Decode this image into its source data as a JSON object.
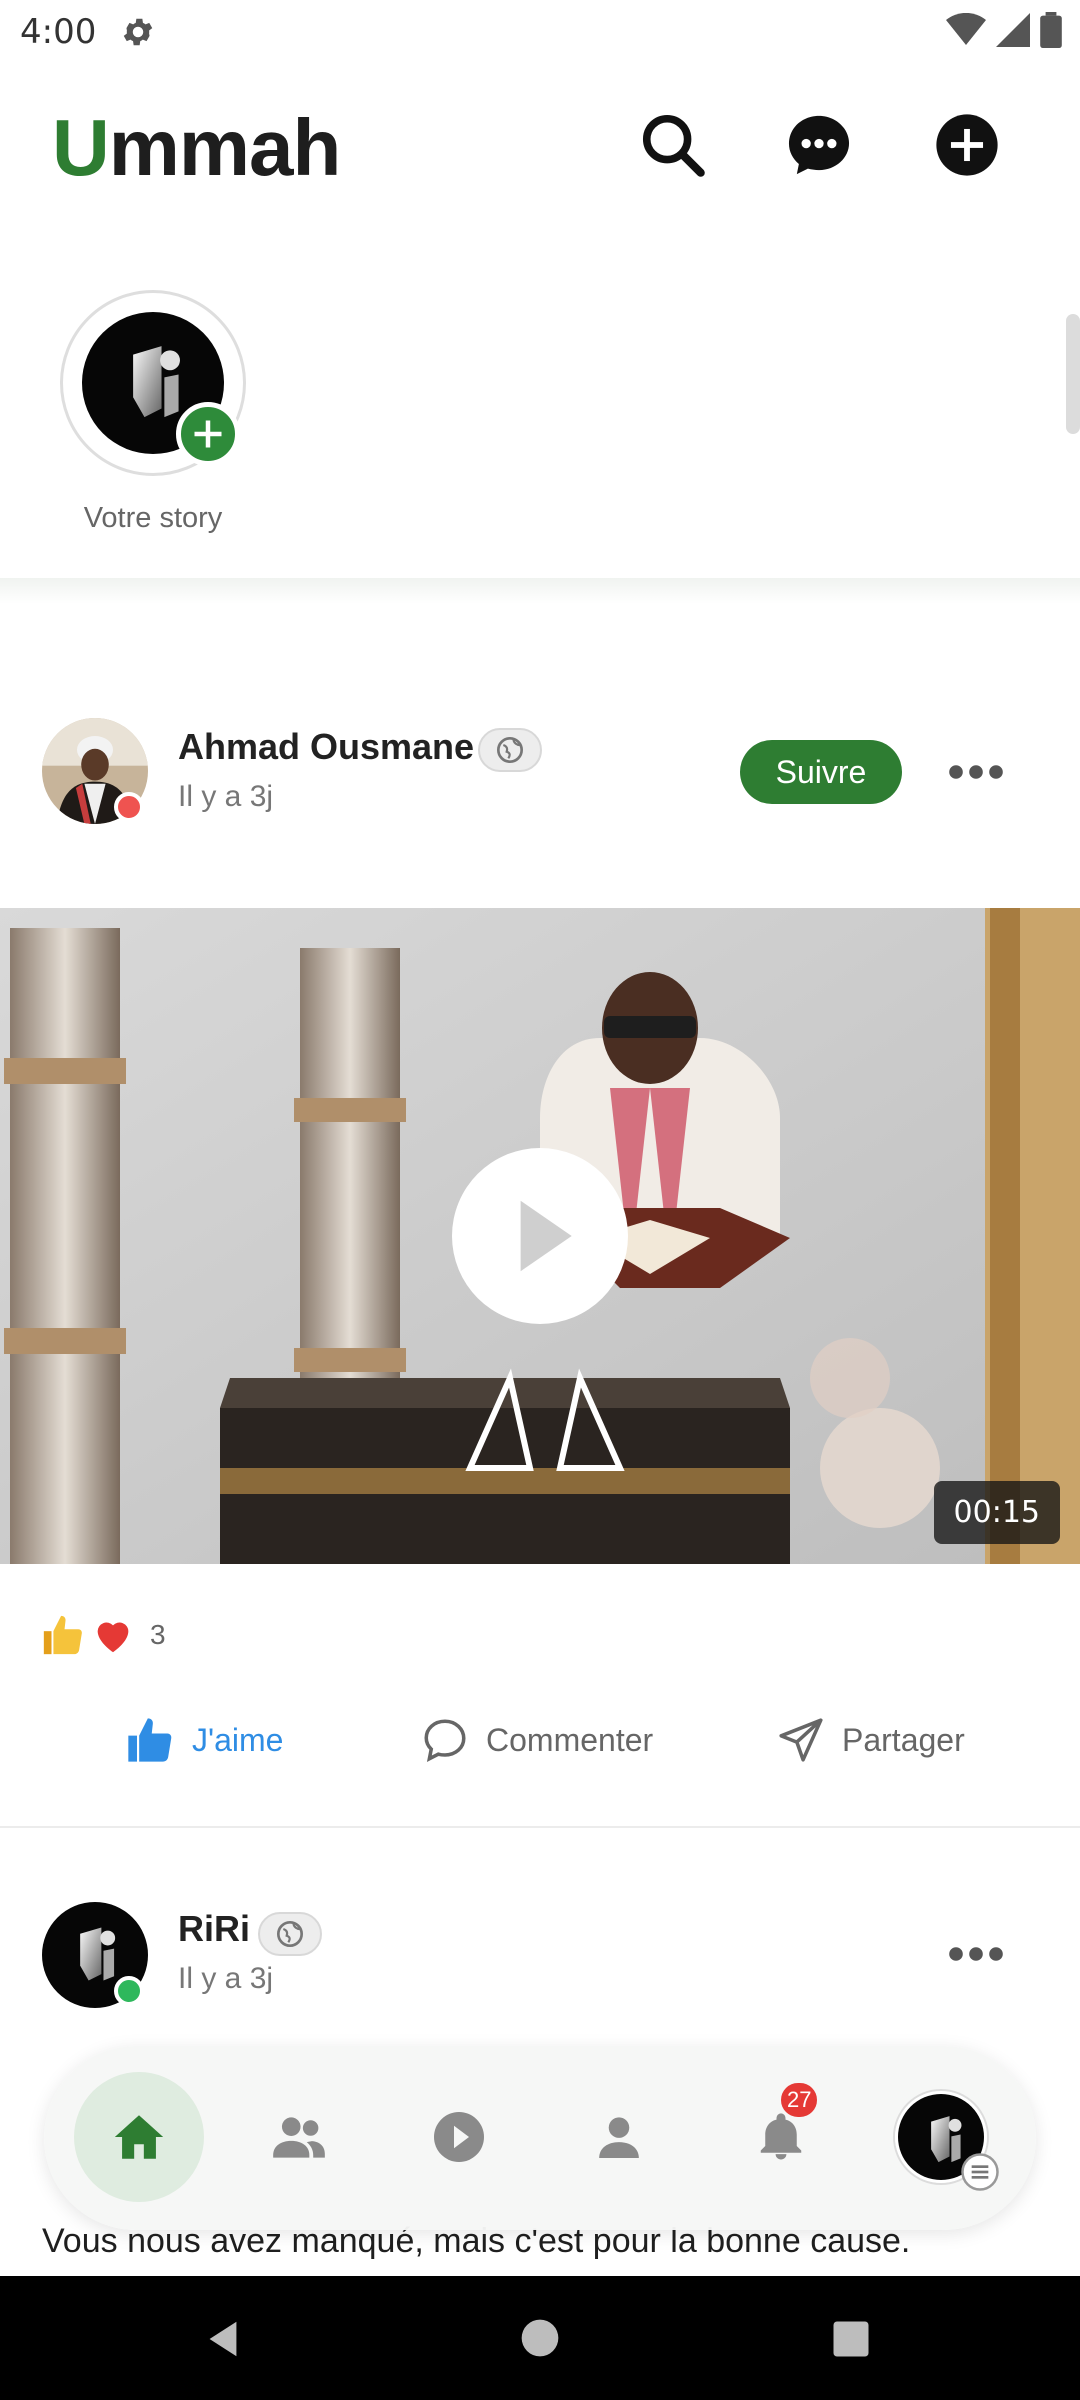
{
  "status_bar": {
    "time": "4:00"
  },
  "header": {
    "logo_first_letter": "U",
    "logo_rest": "mmah"
  },
  "stories": {
    "own_story_label": "Votre story"
  },
  "posts": [
    {
      "author": "Ahmad Ousmane",
      "time": "Il y a 3j",
      "follow_label": "Suivre",
      "video_duration": "00:15",
      "reaction_count": "3",
      "actions": {
        "like": "J'aime",
        "comment": "Commenter",
        "share": "Partager"
      }
    },
    {
      "author": "RiRi",
      "time": "Il y a 3j",
      "text_peek": "Vous nous avez manqué, mais c'est pour la bonne cause."
    }
  ],
  "bottom_nav": {
    "items": [
      "home-icon",
      "friends-icon",
      "video-icon",
      "profile-icon",
      "notifications-icon",
      "account-avatar"
    ],
    "notification_count": "27"
  },
  "colors": {
    "brand_green": "#2e7d32",
    "like_blue": "#2f8de4",
    "badge_red": "#e53935",
    "presence_red": "#ef5350",
    "presence_green": "#2eb85c"
  }
}
